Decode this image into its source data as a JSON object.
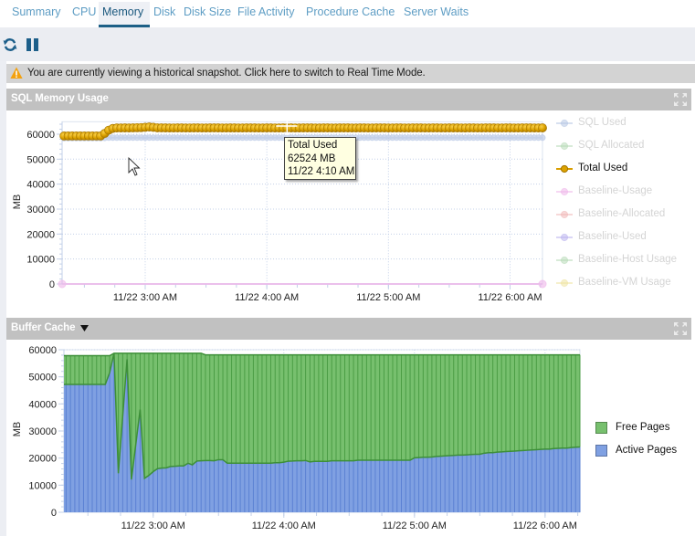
{
  "tabs": [
    {
      "label": "Summary",
      "active": false
    },
    {
      "label": "CPU",
      "active": false
    },
    {
      "label": "Memory",
      "active": true
    },
    {
      "label": "Disk",
      "active": false
    },
    {
      "label": "Disk Size",
      "active": false
    },
    {
      "label": "File Activity",
      "active": false
    },
    {
      "label": "Procedure Cache",
      "active": false
    },
    {
      "label": "Server Waits",
      "active": false
    }
  ],
  "toolbar": {
    "refresh_icon": "refresh-icon",
    "pause_icon": "pause-icon"
  },
  "warning": {
    "icon": "warning-icon",
    "text": "You are currently viewing a historical snapshot. Click here to switch to Real Time Mode."
  },
  "panels": {
    "sql_memory": {
      "title": "SQL Memory Usage",
      "expand_icon": "expand-icon"
    },
    "buffer_cache": {
      "title": "Buffer Cache",
      "dropdown_icon": "caret-down-icon",
      "expand_icon": "expand-icon"
    }
  },
  "tooltip": {
    "series": "Total Used",
    "value": "62524 MB",
    "time": "11/22 4:10 AM"
  },
  "chart_data": [
    {
      "type": "line",
      "title": "SQL Memory Usage",
      "xlabel": "",
      "ylabel": "MB",
      "ylim": [
        0,
        65000
      ],
      "yticks": [
        0,
        10000,
        20000,
        30000,
        40000,
        50000,
        60000
      ],
      "xlim": [
        "11/22 2:19 AM",
        "11/22 6:16 AM"
      ],
      "xticks": [
        "11/22 3:00 AM",
        "11/22 4:00 AM",
        "11/22 5:00 AM",
        "11/22 6:00 AM"
      ],
      "x_start": "11/22 2:20 AM",
      "x_interval_minutes": 2,
      "grid": true,
      "legend": "right",
      "series": [
        {
          "name": "SQL Used",
          "color": "#b7c6e4",
          "enabled": false,
          "values": [
            58400,
            58400,
            58400,
            58400,
            58400,
            58400,
            58400,
            58400,
            58400,
            58400,
            58500,
            58600,
            58600,
            58600,
            58600,
            58600,
            58600,
            58600,
            58600,
            58600,
            58600,
            58600,
            58600,
            58600,
            58600,
            58600,
            58600,
            58600,
            58600,
            58600,
            58600,
            58600,
            58600,
            58600,
            58600,
            58600,
            58600,
            58600,
            58600,
            58600,
            58600,
            58600,
            58600,
            58600,
            58600,
            58600,
            58600,
            58600,
            58600,
            58600,
            58600,
            58600,
            58600,
            58600,
            58600,
            58600,
            58600,
            58600,
            58600,
            58600,
            58600,
            58600,
            58600,
            58600,
            58600,
            58600,
            58600,
            58600,
            58600,
            58600,
            58600,
            58600,
            58600,
            58600,
            58600,
            58600,
            58600,
            58600,
            58600,
            58600,
            58600,
            58600,
            58600,
            58600,
            58600,
            58600,
            58600,
            58600,
            58600,
            58600,
            58600,
            58600,
            58600,
            58600,
            58600,
            58600,
            58600,
            58600,
            58600,
            58600,
            58600,
            58600,
            58600,
            58600,
            58600,
            58600,
            58600,
            58600,
            58600,
            58600,
            58600,
            58600,
            58600,
            58600,
            58600,
            58600,
            58600,
            58600,
            58600
          ]
        },
        {
          "name": "SQL Allocated",
          "color": "#b8dbb8",
          "enabled": false
        },
        {
          "name": "Total Used",
          "color": "#d99e00",
          "enabled": true,
          "values": [
            59300,
            59300,
            59300,
            59300,
            59300,
            59300,
            59300,
            59300,
            59300,
            59300,
            60300,
            61600,
            62300,
            62500,
            62500,
            62520,
            62500,
            62540,
            62600,
            62650,
            62750,
            62900,
            62750,
            62560,
            62540,
            62520,
            62500,
            62510,
            62530,
            62520,
            62500,
            62510,
            62520,
            62530,
            62510,
            62500,
            62520,
            62540,
            62530,
            62510,
            62500,
            62520,
            62530,
            62510,
            62500,
            62520,
            62530,
            62520,
            62510,
            62500,
            62520,
            62530,
            62510,
            62500,
            62520,
            62524,
            62530,
            62510,
            62500,
            62520,
            62530,
            62520,
            62510,
            62500,
            62520,
            62530,
            62510,
            62500,
            62520,
            62530,
            62520,
            62510,
            62500,
            62520,
            62530,
            62510,
            62500,
            62520,
            62530,
            62520,
            62510,
            62500,
            62520,
            62530,
            62510,
            62500,
            62520,
            62530,
            62520,
            62510,
            62500,
            62520,
            62530,
            62510,
            62500,
            62520,
            62530,
            62520,
            62510,
            62500,
            62520,
            62530,
            62510,
            62500,
            62520,
            62530,
            62520,
            62510,
            62500,
            62520,
            62530,
            62510,
            62500,
            62520,
            62530,
            62520,
            62510,
            62500,
            62520
          ]
        },
        {
          "name": "Baseline-Usage",
          "color": "#eeb6ea",
          "enabled": false,
          "x": [
            "11/22 2:19 AM",
            "11/22 6:16 AM"
          ],
          "values": [
            0,
            0
          ]
        },
        {
          "name": "Baseline-Allocated",
          "color": "#f1b8b8",
          "enabled": false
        },
        {
          "name": "Baseline-Used",
          "color": "#bcb5ef",
          "enabled": false
        },
        {
          "name": "Baseline-Host Usage",
          "color": "#b8dab8",
          "enabled": false
        },
        {
          "name": "Baseline-VM Usage",
          "color": "#eee3a2",
          "enabled": false
        }
      ]
    },
    {
      "type": "area",
      "stacked": true,
      "title": "Buffer Cache",
      "xlabel": "",
      "ylabel": "MB",
      "ylim": [
        0,
        60000
      ],
      "yticks": [
        0,
        10000,
        20000,
        30000,
        40000,
        50000,
        60000
      ],
      "xlim": [
        "11/22 2:19 AM",
        "11/22 6:16 AM"
      ],
      "xticks": [
        "11/22 3:00 AM",
        "11/22 4:00 AM",
        "11/22 5:00 AM",
        "11/22 6:00 AM"
      ],
      "x_start": "11/22 2:20 AM",
      "x_interval_minutes": 2,
      "grid": true,
      "legend": "right",
      "series": [
        {
          "name": "Free Pages",
          "color": "#77c06e",
          "values": [
            10600,
            10600,
            10600,
            10600,
            10600,
            10600,
            10600,
            10600,
            10600,
            10600,
            6300,
            0,
            44300,
            23200,
            2200,
            46600,
            33700,
            20800,
            46200,
            45100,
            43700,
            42600,
            42400,
            42300,
            41800,
            41700,
            41600,
            41600,
            40600,
            41200,
            39800,
            39700,
            39000,
            39000,
            39100,
            38700,
            38700,
            40000,
            40000,
            40000,
            40000,
            40000,
            40000,
            40000,
            40000,
            40000,
            40000,
            40000,
            39800,
            39800,
            39600,
            39250,
            39200,
            39100,
            39100,
            39000,
            39500,
            39300,
            39300,
            39300,
            39300,
            39100,
            39100,
            39100,
            39100,
            39100,
            39100,
            38900,
            38900,
            38900,
            38900,
            38900,
            38900,
            38900,
            38900,
            38900,
            38900,
            38900,
            38900,
            38900,
            38000,
            37900,
            37800,
            37800,
            37700,
            37500,
            37400,
            37300,
            37200,
            37100,
            37000,
            37000,
            36900,
            36800,
            36700,
            36700,
            36300,
            36100,
            36100,
            35900,
            35800,
            35700,
            35600,
            35500,
            35400,
            35300,
            35200,
            35100,
            35000,
            34900,
            34800,
            34800,
            34600,
            34500,
            34400,
            34400,
            34200,
            34100,
            34000
          ]
        },
        {
          "name": "Active Pages",
          "color": "#7fa0e2",
          "values": [
            47200,
            47200,
            47200,
            47200,
            47200,
            47200,
            47200,
            47200,
            47200,
            47200,
            51500,
            58700,
            14400,
            35500,
            56500,
            12100,
            25000,
            37900,
            12500,
            13600,
            15000,
            16100,
            16300,
            16400,
            16900,
            17000,
            17100,
            17100,
            18100,
            17500,
            18900,
            19000,
            19100,
            19100,
            19000,
            19400,
            19400,
            18100,
            18100,
            18100,
            18100,
            18100,
            18100,
            18100,
            18100,
            18100,
            18100,
            18100,
            18300,
            18300,
            18500,
            18850,
            18900,
            19000,
            19000,
            19100,
            18600,
            18800,
            18800,
            18800,
            18800,
            19000,
            19000,
            19000,
            19000,
            19000,
            19000,
            19200,
            19200,
            19200,
            19200,
            19200,
            19200,
            19200,
            19200,
            19200,
            19200,
            19200,
            19200,
            19200,
            20100,
            20200,
            20300,
            20300,
            20400,
            20600,
            20700,
            20800,
            20900,
            21000,
            21100,
            21100,
            21200,
            21300,
            21400,
            21400,
            21800,
            22000,
            22000,
            22200,
            22300,
            22400,
            22500,
            22600,
            22700,
            22800,
            22900,
            23000,
            23100,
            23200,
            23300,
            23300,
            23500,
            23600,
            23700,
            23700,
            23900,
            24000,
            24100
          ]
        }
      ]
    }
  ]
}
